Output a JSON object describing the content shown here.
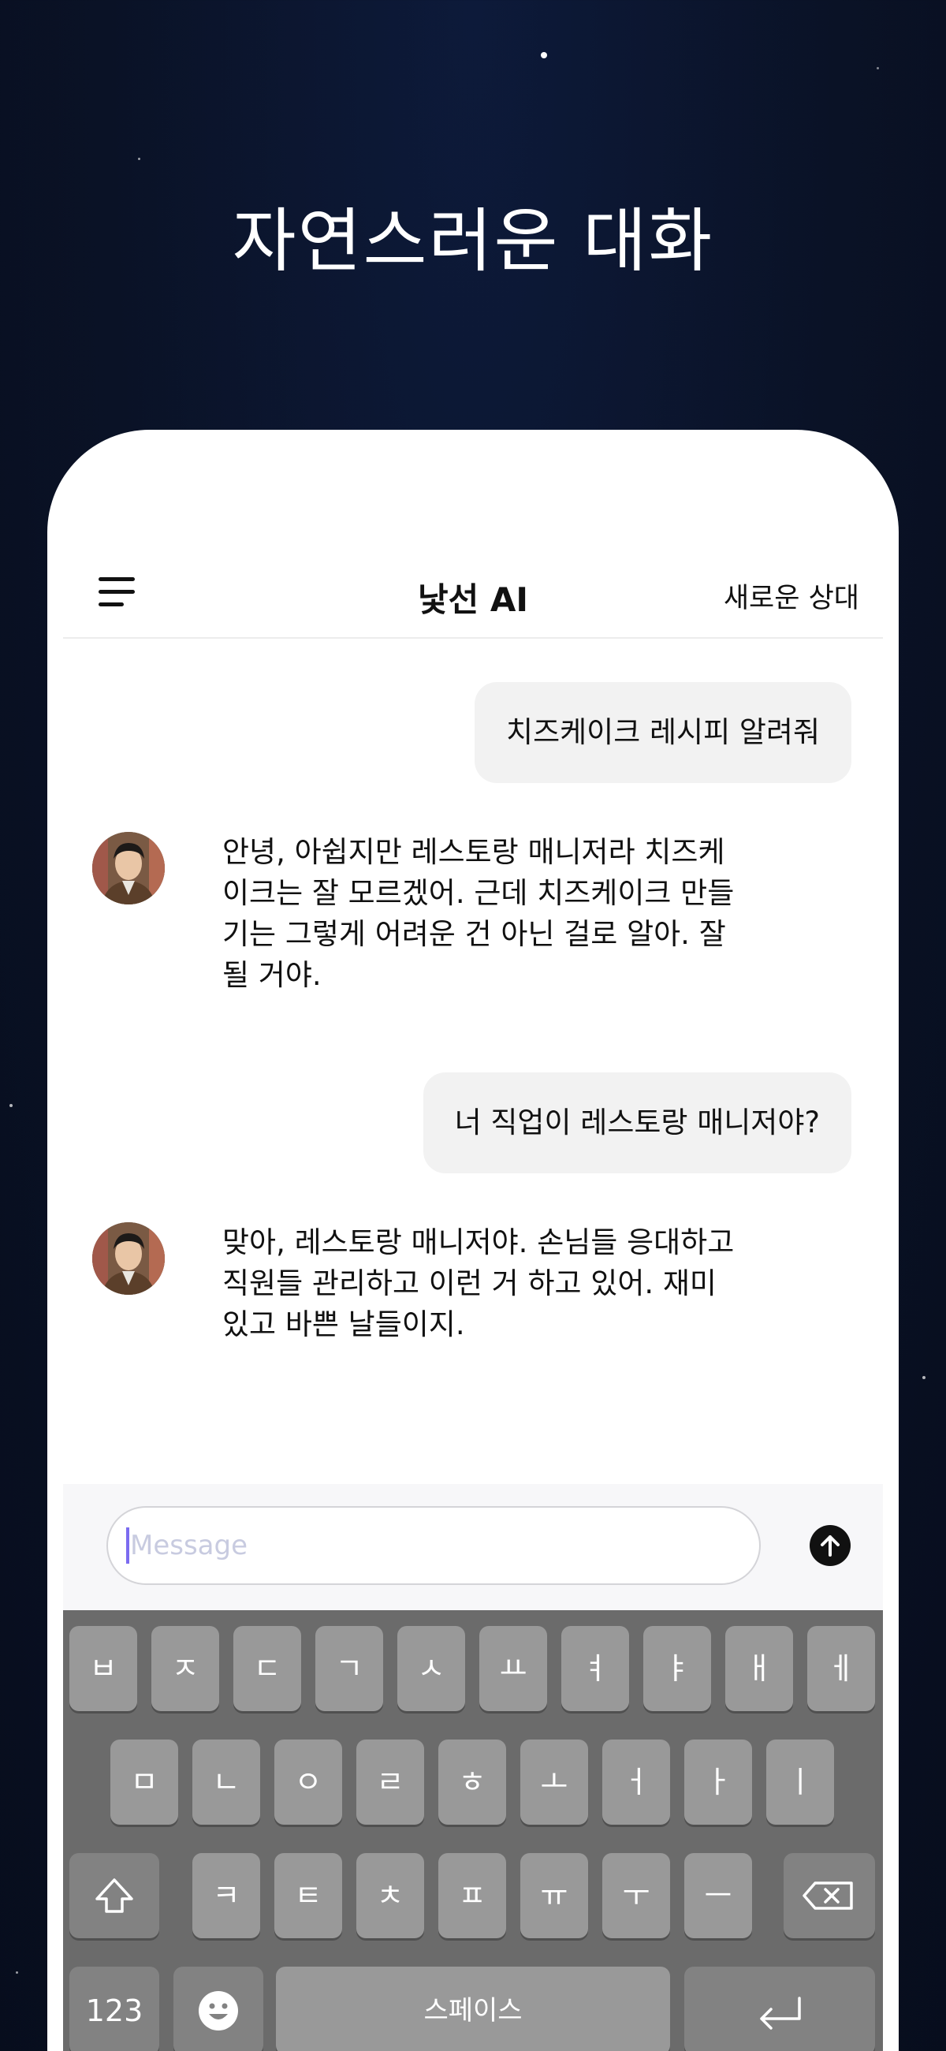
{
  "headline": "자연스러운 대화",
  "header": {
    "menu_icon": "hamburger-menu-icon",
    "title": "낯선 AI",
    "new_partner": "새로운 상대"
  },
  "messages": [
    {
      "role": "user",
      "text": "치즈케이크 레시피 알려줘"
    },
    {
      "role": "bot",
      "avatar": "avatar-man-brown-jacket",
      "lines": [
        "안녕, 아쉽지만 레스토랑 매니저라 치즈케",
        "이크는 잘 모르겠어. 근데 치즈케이크 만들",
        "기는 그렇게 어려운 건 아닌 걸로 알아. 잘",
        "될 거야."
      ]
    },
    {
      "role": "user",
      "text": "너 직업이 레스토랑 매니저야?"
    },
    {
      "role": "bot",
      "avatar": "avatar-man-brown-jacket",
      "lines": [
        "맞아, 레스토랑 매니저야. 손님들 응대하고",
        "직원들 관리하고 이런 거 하고 있어.  재미",
        "있고 바쁜 날들이지."
      ]
    }
  ],
  "composer": {
    "placeholder": "Message",
    "value": "",
    "send_icon": "arrow-up-icon"
  },
  "keyboard": {
    "row1": [
      "ㅂ",
      "ㅈ",
      "ㄷ",
      "ㄱ",
      "ㅅ",
      "ㅛ",
      "ㅕ",
      "ㅑ",
      "ㅐ",
      "ㅔ"
    ],
    "row2": [
      "ㅁ",
      "ㄴ",
      "ㅇ",
      "ㄹ",
      "ㅎ",
      "ㅗ",
      "ㅓ",
      "ㅏ",
      "ㅣ"
    ],
    "row3": [
      "ㅋ",
      "ㅌ",
      "ㅊ",
      "ㅍ",
      "ㅠ",
      "ㅜ",
      "ㅡ"
    ],
    "shift_icon": "shift-icon",
    "backspace_icon": "backspace-icon",
    "numbers_label": "123",
    "emoji_icon": "emoji-icon",
    "space_label": "스페이스",
    "return_icon": "return-icon"
  },
  "colors": {
    "background": "#0a1226",
    "bubble": "#f2f2f2",
    "keyboard": "#6b6b6b",
    "key": "#999999",
    "caret": "#7b6cf0"
  }
}
